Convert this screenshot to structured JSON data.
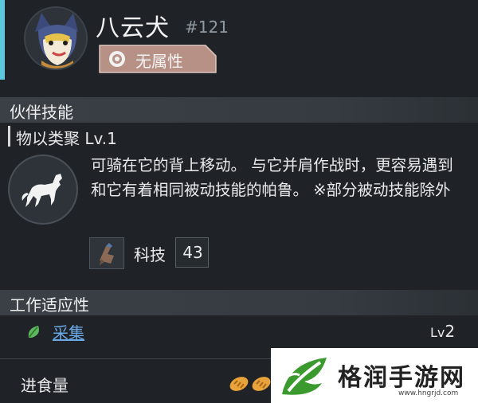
{
  "pal": {
    "name": "八云犬",
    "number": "#121",
    "element": {
      "label": "无属性",
      "icon": "neutral-element-icon"
    }
  },
  "sections": {
    "partner_skill": "伙伴技能",
    "work_suitability": "工作适应性"
  },
  "skill": {
    "title": "物以类聚 Lv.1",
    "icon": "horse-icon",
    "description": "可骑在它的背上移动。 与它并肩作战时，更容易遇到和它有着相同被动技能的帕鲁。 ※部分被动技能除外"
  },
  "tech": {
    "label": "科技",
    "value": "43",
    "icon": "tech-item-icon"
  },
  "work": [
    {
      "label": "采集",
      "level_prefix": "Lv",
      "level": "2",
      "icon": "leaf-icon",
      "color": "#6aa9e6"
    }
  ],
  "food": {
    "label": "进食量",
    "icon": "bread-icon"
  },
  "colors": {
    "accent": "#5ec8df",
    "background": "#1f2328",
    "link": "#6aa9e6"
  },
  "watermark": {
    "text": "格润手游网",
    "url": "www.hngrjd.com"
  }
}
